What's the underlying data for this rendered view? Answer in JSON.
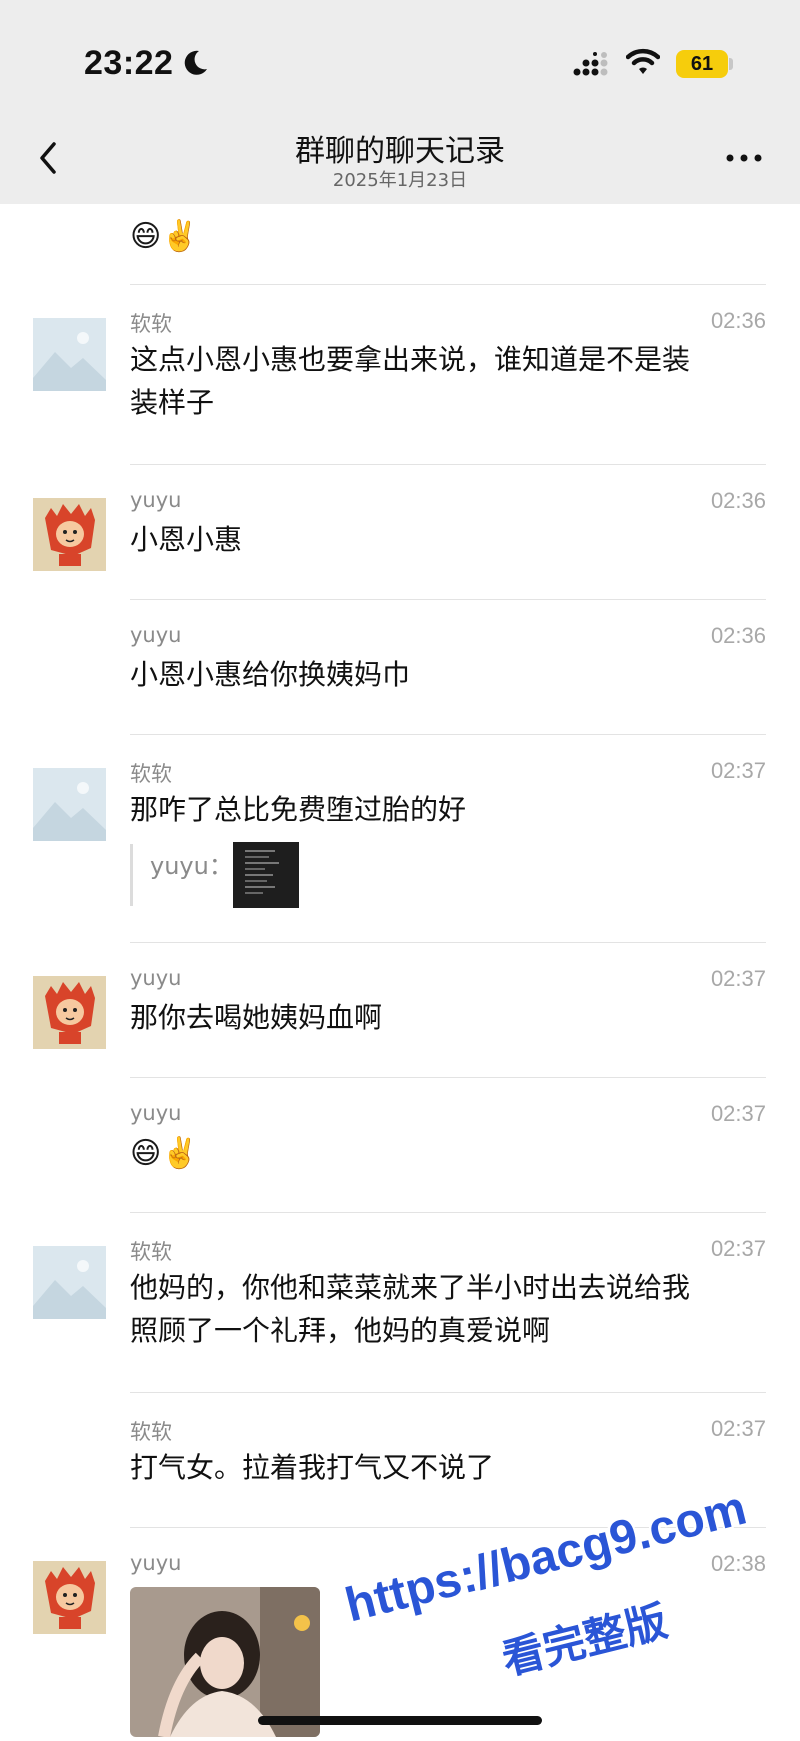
{
  "status": {
    "time": "23:22",
    "battery": "61"
  },
  "header": {
    "title": "群聊的聊天记录",
    "date": "2025年1月23日"
  },
  "top_partial": {
    "emoji": "😄✌️"
  },
  "messages": [
    {
      "sender": "软软",
      "time": "02:36",
      "text_line1": "这点小恩小惠也要拿出来说，谁知道是不是装",
      "text_line2": "装样子",
      "avatar": "placeholder"
    },
    {
      "sender": "yuyu",
      "time": "02:36",
      "text": "小恩小惠",
      "avatar": "cartoon"
    },
    {
      "sender": "yuyu",
      "time": "02:36",
      "text": "小恩小惠给你换姨妈巾"
    },
    {
      "sender": "软软",
      "time": "02:37",
      "text": "那咋了总比免费堕过胎的好",
      "quote_label": "yuyu：",
      "avatar": "placeholder"
    },
    {
      "sender": "yuyu",
      "time": "02:37",
      "text": "那你去喝她姨妈血啊",
      "avatar": "cartoon"
    },
    {
      "sender": "yuyu",
      "time": "02:37",
      "emoji": "😄✌️"
    },
    {
      "sender": "软软",
      "time": "02:37",
      "text_line1": "他妈的，你他和菜菜就来了半小时出去说给我",
      "text_line2": "照顾了一个礼拜，他妈的真爱说啊",
      "avatar": "placeholder"
    },
    {
      "sender": "软软",
      "time": "02:37",
      "text": "打气女。拉着我打气又不说了"
    },
    {
      "sender": "yuyu",
      "time": "02:38",
      "avatar": "cartoon"
    }
  ],
  "watermark": {
    "line1": "https://bacg9.com",
    "line2": "看完整版"
  },
  "colors": {
    "bar_bg": "#ededed",
    "battery": "#f6cd0c",
    "watermark": "#2a55d6"
  }
}
